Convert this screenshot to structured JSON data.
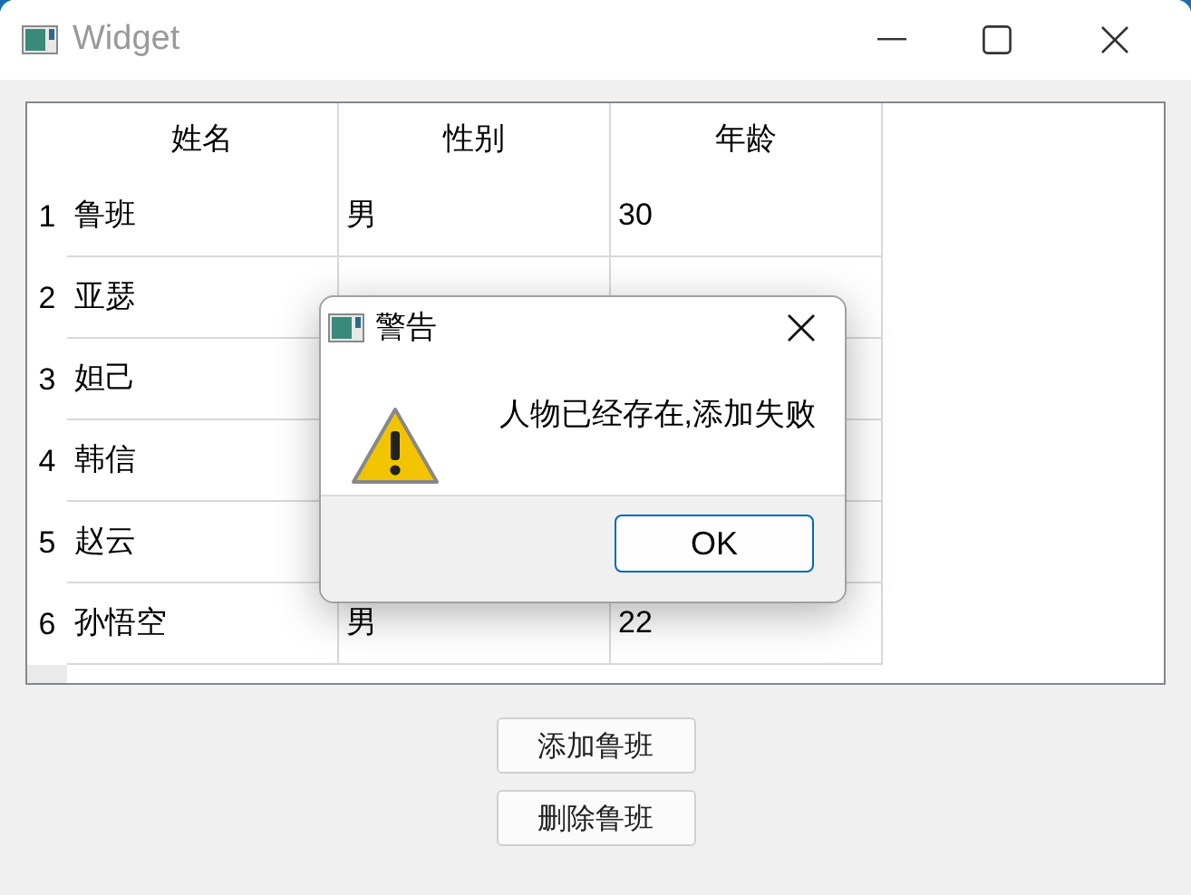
{
  "window": {
    "title": "Widget"
  },
  "table": {
    "columns": [
      "姓名",
      "性别",
      "年龄"
    ],
    "rows": [
      {
        "number": "1",
        "cells": [
          "鲁班",
          "男",
          "30"
        ]
      },
      {
        "number": "2",
        "cells": [
          "亚瑟"
        ]
      },
      {
        "number": "3",
        "cells": [
          "妲己"
        ]
      },
      {
        "number": "4",
        "cells": [
          "韩信"
        ]
      },
      {
        "number": "5",
        "cells": [
          "赵云"
        ]
      },
      {
        "number": "6",
        "cells": [
          "孙悟空",
          "男",
          "22"
        ]
      }
    ]
  },
  "buttons": [
    "添加鲁班",
    "删除鲁班"
  ],
  "dialog": {
    "title": "警告",
    "message": "人物已经存在,添加失败",
    "button": "OK"
  }
}
